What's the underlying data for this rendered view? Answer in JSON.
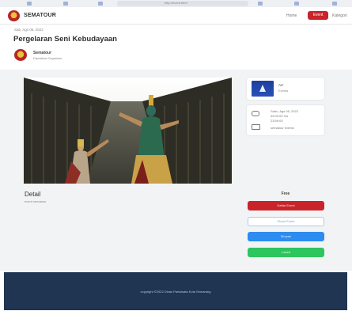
{
  "browser": {
    "url": "http://event.html"
  },
  "header": {
    "brand": "SEMATOUR",
    "nav": {
      "home": "Home",
      "event": "Event",
      "kategori": "Kategori"
    }
  },
  "event": {
    "date_top": "Sab, Ags 06, 2022",
    "title": "Pergelaran Seni Kebudayaan",
    "organizer": {
      "name": "Sematour",
      "subtitle": "Dipostkan Organizer"
    },
    "category": {
      "name": "Art",
      "subtitle": "Events"
    },
    "info": {
      "line1": "Sabu, Ags 06, 2022",
      "line2": "09:00:00 hrs",
      "line3": "23:59:00",
      "line4": "sematour events"
    },
    "detail": {
      "title": "Detail",
      "subtitle": "event sematour"
    },
    "price": "Free",
    "buttons": {
      "register": "Daftar Event",
      "share": "Share Event",
      "blue": "Simpan",
      "green": "Lokasi"
    }
  },
  "footer": {
    "text": "copyright ©2022 Dinas Pariwisata Kota Semarang"
  },
  "colors": {
    "brand_red": "#c8242a",
    "blue": "#2d8cf0",
    "green": "#2dc55e",
    "footer": "#1f3552"
  }
}
